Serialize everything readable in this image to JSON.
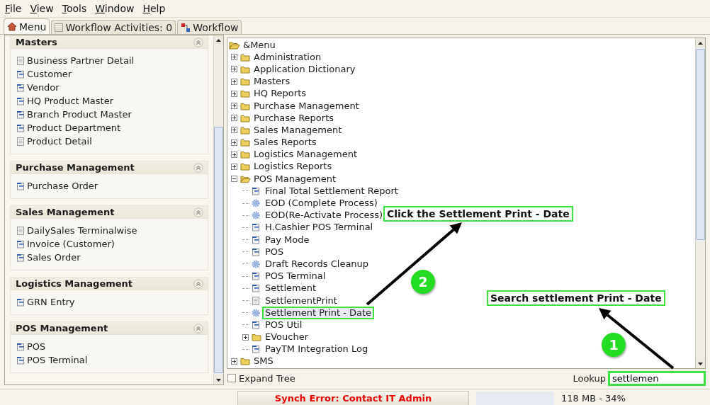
{
  "menu_bar": [
    {
      "label": "File"
    },
    {
      "label": "View"
    },
    {
      "label": "Tools"
    },
    {
      "label": "Window"
    },
    {
      "label": "Help"
    }
  ],
  "tabs": [
    {
      "label": "Menu",
      "kind": "home",
      "selected": true
    },
    {
      "label": "Workflow Activities: 0",
      "kind": "table",
      "selected": false
    },
    {
      "label": "Workflow",
      "kind": "flow",
      "selected": false
    }
  ],
  "sidebar": {
    "sections": [
      {
        "title": "Masters",
        "items": [
          {
            "label": "Business Partner Detail",
            "kind": "report"
          },
          {
            "label": "Customer",
            "kind": "window"
          },
          {
            "label": "Vendor",
            "kind": "window"
          },
          {
            "label": "HQ Product Master",
            "kind": "window"
          },
          {
            "label": "Branch Product Master",
            "kind": "window"
          },
          {
            "label": "Product Department",
            "kind": "window"
          },
          {
            "label": "Product Detail",
            "kind": "report"
          }
        ]
      },
      {
        "title": "Purchase Management",
        "items": [
          {
            "label": "Purchase Order",
            "kind": "window"
          }
        ]
      },
      {
        "title": "Sales Management",
        "items": [
          {
            "label": "DailySales Terminalwise",
            "kind": "report"
          },
          {
            "label": "Invoice (Customer)",
            "kind": "window"
          },
          {
            "label": "Sales Order",
            "kind": "window"
          }
        ]
      },
      {
        "title": "Logistics Management",
        "items": [
          {
            "label": "GRN Entry",
            "kind": "window"
          }
        ]
      },
      {
        "title": "POS Management",
        "items": [
          {
            "label": "POS",
            "kind": "window"
          },
          {
            "label": "POS Terminal",
            "kind": "window"
          }
        ]
      }
    ]
  },
  "tree": {
    "root": {
      "label": "&Menu",
      "expanded": true
    },
    "children": [
      {
        "label": "Administration",
        "kind": "folder",
        "expanded": false,
        "selected": false
      },
      {
        "label": "Application Dictionary",
        "kind": "folder",
        "expanded": false,
        "selected": false
      },
      {
        "label": "Masters",
        "kind": "folder",
        "expanded": false,
        "selected": false
      },
      {
        "label": "HQ Reports",
        "kind": "folder",
        "expanded": false,
        "selected": false
      },
      {
        "label": "Purchase Management",
        "kind": "folder",
        "expanded": false,
        "selected": false
      },
      {
        "label": "Purchase Reports",
        "kind": "folder",
        "expanded": false,
        "selected": false
      },
      {
        "label": "Sales Management",
        "kind": "folder",
        "expanded": false,
        "selected": false
      },
      {
        "label": "Sales Reports",
        "kind": "folder",
        "expanded": false,
        "selected": false
      },
      {
        "label": "Logistics Management",
        "kind": "folder",
        "expanded": false,
        "selected": false
      },
      {
        "label": "Logistics Reports",
        "kind": "folder",
        "expanded": false,
        "selected": false
      },
      {
        "label": "POS Management",
        "kind": "folder",
        "expanded": true,
        "selected": false,
        "children": [
          {
            "label": "Final Total Settlement Report",
            "kind": "window",
            "selected": false
          },
          {
            "label": "EOD (Complete Process)",
            "kind": "process",
            "selected": false
          },
          {
            "label": "EOD(Re-Activate Process)",
            "kind": "process",
            "selected": false
          },
          {
            "label": "H.Cashier POS Terminal",
            "kind": "window",
            "selected": false
          },
          {
            "label": "Pay Mode",
            "kind": "window",
            "selected": false
          },
          {
            "label": "POS",
            "kind": "window",
            "selected": false
          },
          {
            "label": "Draft Records Cleanup",
            "kind": "process",
            "selected": false
          },
          {
            "label": "POS Terminal",
            "kind": "window",
            "selected": false
          },
          {
            "label": "Settlement",
            "kind": "window",
            "selected": false
          },
          {
            "label": "SettlementPrint",
            "kind": "report",
            "selected": false
          },
          {
            "label": "Settlement Print - Date",
            "kind": "process",
            "selected": true
          },
          {
            "label": "POS Util",
            "kind": "window",
            "selected": false
          },
          {
            "label": "EVoucher",
            "kind": "folder",
            "expanded": false,
            "selected": false
          },
          {
            "label": "PayTM Integration Log",
            "kind": "window",
            "selected": false
          }
        ]
      },
      {
        "label": "SMS",
        "kind": "folder",
        "expanded": false,
        "selected": false
      }
    ]
  },
  "expand_tree": {
    "label": "Expand Tree",
    "checked": false
  },
  "lookup": {
    "label": "Lookup",
    "value": "settlemen",
    "highlighted": true
  },
  "status_bar": {
    "error": "Synch Error: Contact IT Admin",
    "memory": "118 MB - 34%"
  },
  "annotations": [
    {
      "kind": "callout",
      "text": "Click the Settlement Print - Date"
    },
    {
      "kind": "badge",
      "text": "2"
    },
    {
      "kind": "callout",
      "text": "Search settlement Print - Date"
    },
    {
      "kind": "badge",
      "text": "1"
    }
  ]
}
